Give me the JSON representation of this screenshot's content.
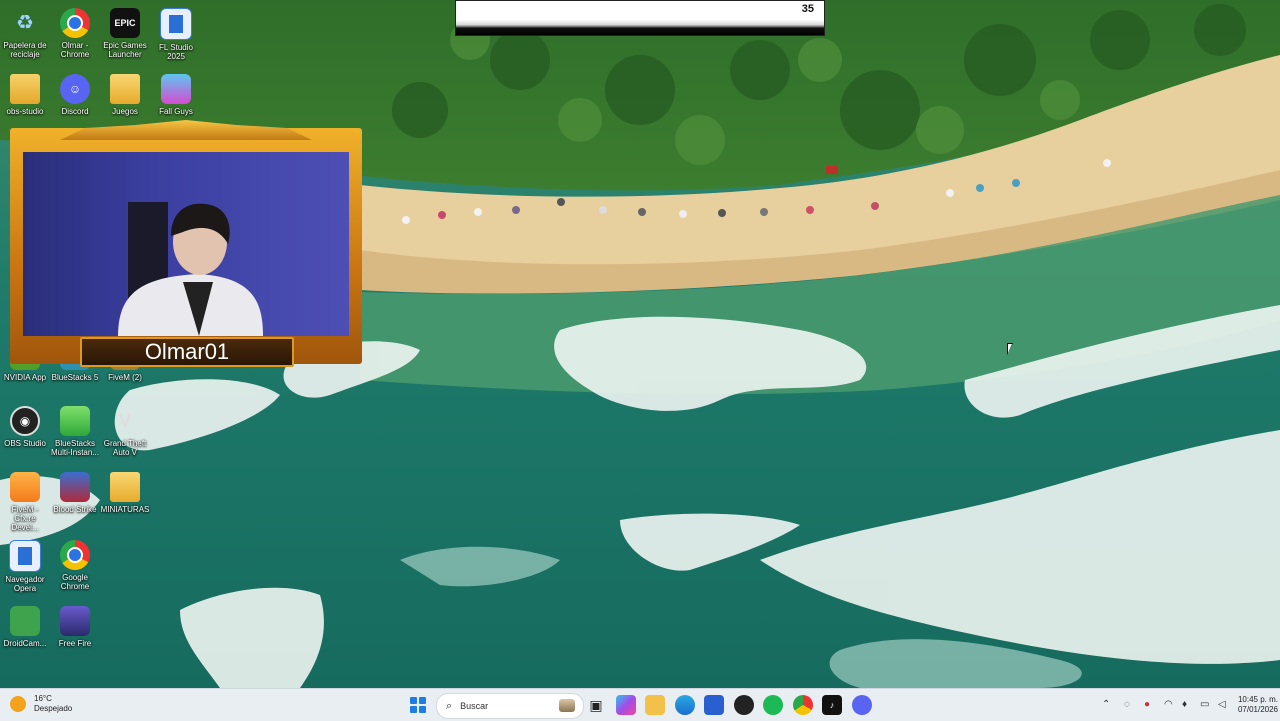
{
  "top_overlay": {
    "count": "35"
  },
  "webcam": {
    "name": "Olmar01"
  },
  "desktop_icons": {
    "recycle_bin": "Papelera de reciclaje",
    "olmar_chrome": "Olmar - Chrome",
    "epic_games": "Epic Games Launcher",
    "epic_badge": "EPIC",
    "fl_studio": "FL Studio 2025",
    "obs_studio_top": "obs-studio",
    "discord": "Discord",
    "juegos": "Juegos",
    "fall_guys": "Fall Guys",
    "nvidia_app": "NVIDIA App",
    "bluestacks5": "BlueStacks 5",
    "fivem_2": "FiveM (2)",
    "obs_studio": "OBS Studio",
    "bluestacks_multi": "BlueStacks Multi-Instan...",
    "gta_v": "Grand Theft Auto V",
    "fivem_devel": "FiveM - Cfx.re Devel...",
    "blood_strike": "Blood Strike",
    "miniaturas": "MINIATURAS",
    "opera": "Navegador Opera",
    "google_chrome": "Google Chrome",
    "droidcam": "DroidCam...",
    "free_fire": "Free Fire"
  },
  "taskbar": {
    "weather_temp": "16°C",
    "weather_desc": "Despejado",
    "search_placeholder": "Buscar",
    "time": "10:45 p. m.",
    "date": "07/01/2026"
  }
}
